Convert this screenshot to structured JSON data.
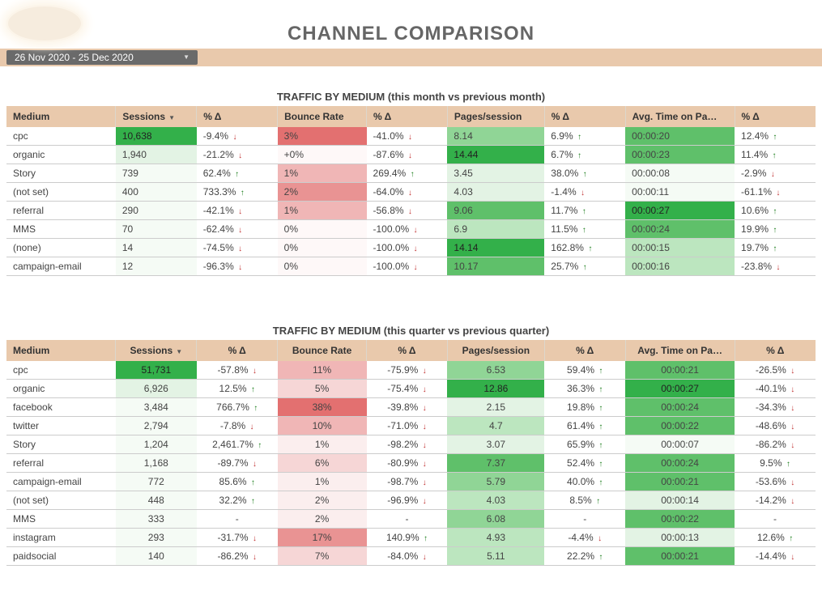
{
  "header": {
    "title": "CHANNEL COMPARISON",
    "date_range": "26 Nov 2020 - 25 Dec 2020"
  },
  "columns_labels": {
    "medium": "Medium",
    "sessions": "Sessions",
    "delta": "% Δ",
    "bounce": "Bounce Rate",
    "pages": "Pages/session",
    "time": "Avg. Time on Pa…"
  },
  "table1": {
    "title": "TRAFFIC BY MEDIUM (this month vs previous month)",
    "rows": [
      {
        "medium": "cpc",
        "sessions": "10,638",
        "sessions_cls": "g5",
        "sessions_d": "-9.4%",
        "sessions_dir": "down",
        "bounce": "3%",
        "bounce_cls": "r5",
        "bounce_d": "-41.0%",
        "bounce_dir": "down",
        "pages": "8.14",
        "pages_cls": "g3",
        "pages_d": "6.9%",
        "pages_dir": "up",
        "time": "00:00:20",
        "time_cls": "g4",
        "time_d": "12.4%",
        "time_dir": "up"
      },
      {
        "medium": "organic",
        "sessions": "1,940",
        "sessions_cls": "g1",
        "sessions_d": "-21.2%",
        "sessions_dir": "down",
        "bounce": "+0%",
        "bounce_cls": "r0",
        "bounce_d": "-87.6%",
        "bounce_dir": "down",
        "pages": "14.44",
        "pages_cls": "g5",
        "pages_d": "6.7%",
        "pages_dir": "up",
        "time": "00:00:23",
        "time_cls": "g4",
        "time_d": "11.4%",
        "time_dir": "up"
      },
      {
        "medium": "Story",
        "sessions": "739",
        "sessions_cls": "g0",
        "sessions_d": "62.4%",
        "sessions_dir": "up",
        "bounce": "1%",
        "bounce_cls": "r3",
        "bounce_d": "269.4%",
        "bounce_dir": "up",
        "pages": "3.45",
        "pages_cls": "g1",
        "pages_d": "38.0%",
        "pages_dir": "up",
        "time": "00:00:08",
        "time_cls": "g0",
        "time_d": "-2.9%",
        "time_dir": "down"
      },
      {
        "medium": "(not set)",
        "sessions": "400",
        "sessions_cls": "g0",
        "sessions_d": "733.3%",
        "sessions_dir": "up",
        "bounce": "2%",
        "bounce_cls": "r4",
        "bounce_d": "-64.0%",
        "bounce_dir": "down",
        "pages": "4.03",
        "pages_cls": "g1",
        "pages_d": "-1.4%",
        "pages_dir": "down",
        "time": "00:00:11",
        "time_cls": "g0",
        "time_d": "-61.1%",
        "time_dir": "down"
      },
      {
        "medium": "referral",
        "sessions": "290",
        "sessions_cls": "g0",
        "sessions_d": "-42.1%",
        "sessions_dir": "down",
        "bounce": "1%",
        "bounce_cls": "r3",
        "bounce_d": "-56.8%",
        "bounce_dir": "down",
        "pages": "9.06",
        "pages_cls": "g4",
        "pages_d": "11.7%",
        "pages_dir": "up",
        "time": "00:00:27",
        "time_cls": "g5",
        "time_d": "10.6%",
        "time_dir": "up"
      },
      {
        "medium": "MMS",
        "sessions": "70",
        "sessions_cls": "g0",
        "sessions_d": "-62.4%",
        "sessions_dir": "down",
        "bounce": "0%",
        "bounce_cls": "r0",
        "bounce_d": "-100.0%",
        "bounce_dir": "down",
        "pages": "6.9",
        "pages_cls": "g2",
        "pages_d": "11.5%",
        "pages_dir": "up",
        "time": "00:00:24",
        "time_cls": "g4",
        "time_d": "19.9%",
        "time_dir": "up"
      },
      {
        "medium": "(none)",
        "sessions": "14",
        "sessions_cls": "g0",
        "sessions_d": "-74.5%",
        "sessions_dir": "down",
        "bounce": "0%",
        "bounce_cls": "r0",
        "bounce_d": "-100.0%",
        "bounce_dir": "down",
        "pages": "14.14",
        "pages_cls": "g5",
        "pages_d": "162.8%",
        "pages_dir": "up",
        "time": "00:00:15",
        "time_cls": "g2",
        "time_d": "19.7%",
        "time_dir": "up"
      },
      {
        "medium": "campaign-email",
        "sessions": "12",
        "sessions_cls": "g0",
        "sessions_d": "-96.3%",
        "sessions_dir": "down",
        "bounce": "0%",
        "bounce_cls": "r0",
        "bounce_d": "-100.0%",
        "bounce_dir": "down",
        "pages": "10.17",
        "pages_cls": "g4",
        "pages_d": "25.7%",
        "pages_dir": "up",
        "time": "00:00:16",
        "time_cls": "g2",
        "time_d": "-23.8%",
        "time_dir": "down"
      }
    ]
  },
  "table2": {
    "title": "TRAFFIC BY MEDIUM (this quarter vs previous quarter)",
    "align": "center",
    "rows": [
      {
        "medium": "cpc",
        "sessions": "51,731",
        "sessions_cls": "g5",
        "sessions_d": "-57.8%",
        "sessions_dir": "down",
        "bounce": "11%",
        "bounce_cls": "r3",
        "bounce_d": "-75.9%",
        "bounce_dir": "down",
        "pages": "6.53",
        "pages_cls": "g3",
        "pages_d": "59.4%",
        "pages_dir": "up",
        "time": "00:00:21",
        "time_cls": "g4",
        "time_d": "-26.5%",
        "time_dir": "down"
      },
      {
        "medium": "organic",
        "sessions": "6,926",
        "sessions_cls": "g1",
        "sessions_d": "12.5%",
        "sessions_dir": "up",
        "bounce": "5%",
        "bounce_cls": "r2",
        "bounce_d": "-75.4%",
        "bounce_dir": "down",
        "pages": "12.86",
        "pages_cls": "g5",
        "pages_d": "36.3%",
        "pages_dir": "up",
        "time": "00:00:27",
        "time_cls": "g5",
        "time_d": "-40.1%",
        "time_dir": "down"
      },
      {
        "medium": "facebook",
        "sessions": "3,484",
        "sessions_cls": "g0",
        "sessions_d": "766.7%",
        "sessions_dir": "up",
        "bounce": "38%",
        "bounce_cls": "r5",
        "bounce_d": "-39.8%",
        "bounce_dir": "down",
        "pages": "2.15",
        "pages_cls": "g1",
        "pages_d": "19.8%",
        "pages_dir": "up",
        "time": "00:00:24",
        "time_cls": "g4",
        "time_d": "-34.3%",
        "time_dir": "down"
      },
      {
        "medium": "twitter",
        "sessions": "2,794",
        "sessions_cls": "g0",
        "sessions_d": "-7.8%",
        "sessions_dir": "down",
        "bounce": "10%",
        "bounce_cls": "r3",
        "bounce_d": "-71.0%",
        "bounce_dir": "down",
        "pages": "4.7",
        "pages_cls": "g2",
        "pages_d": "61.4%",
        "pages_dir": "up",
        "time": "00:00:22",
        "time_cls": "g4",
        "time_d": "-48.6%",
        "time_dir": "down"
      },
      {
        "medium": "Story",
        "sessions": "1,204",
        "sessions_cls": "g0",
        "sessions_d": "2,461.7%",
        "sessions_dir": "up",
        "bounce": "1%",
        "bounce_cls": "r1",
        "bounce_d": "-98.2%",
        "bounce_dir": "down",
        "pages": "3.07",
        "pages_cls": "g1",
        "pages_d": "65.9%",
        "pages_dir": "up",
        "time": "00:00:07",
        "time_cls": "g0",
        "time_d": "-86.2%",
        "time_dir": "down"
      },
      {
        "medium": "referral",
        "sessions": "1,168",
        "sessions_cls": "g0",
        "sessions_d": "-89.7%",
        "sessions_dir": "down",
        "bounce": "6%",
        "bounce_cls": "r2",
        "bounce_d": "-80.9%",
        "bounce_dir": "down",
        "pages": "7.37",
        "pages_cls": "g4",
        "pages_d": "52.4%",
        "pages_dir": "up",
        "time": "00:00:24",
        "time_cls": "g4",
        "time_d": "9.5%",
        "time_dir": "up"
      },
      {
        "medium": "campaign-email",
        "sessions": "772",
        "sessions_cls": "g0",
        "sessions_d": "85.6%",
        "sessions_dir": "up",
        "bounce": "1%",
        "bounce_cls": "r1",
        "bounce_d": "-98.7%",
        "bounce_dir": "down",
        "pages": "5.79",
        "pages_cls": "g3",
        "pages_d": "40.0%",
        "pages_dir": "up",
        "time": "00:00:21",
        "time_cls": "g4",
        "time_d": "-53.6%",
        "time_dir": "down"
      },
      {
        "medium": "(not set)",
        "sessions": "448",
        "sessions_cls": "g0",
        "sessions_d": "32.2%",
        "sessions_dir": "up",
        "bounce": "2%",
        "bounce_cls": "r1",
        "bounce_d": "-96.9%",
        "bounce_dir": "down",
        "pages": "4.03",
        "pages_cls": "g2",
        "pages_d": "8.5%",
        "pages_dir": "up",
        "time": "00:00:14",
        "time_cls": "g1",
        "time_d": "-14.2%",
        "time_dir": "down"
      },
      {
        "medium": "MMS",
        "sessions": "333",
        "sessions_cls": "g0",
        "sessions_d": "-",
        "sessions_dir": "",
        "bounce": "2%",
        "bounce_cls": "r1",
        "bounce_d": "-",
        "bounce_dir": "",
        "pages": "6.08",
        "pages_cls": "g3",
        "pages_d": "-",
        "pages_dir": "",
        "time": "00:00:22",
        "time_cls": "g4",
        "time_d": "-",
        "time_dir": ""
      },
      {
        "medium": "instagram",
        "sessions": "293",
        "sessions_cls": "g0",
        "sessions_d": "-31.7%",
        "sessions_dir": "down",
        "bounce": "17%",
        "bounce_cls": "r4",
        "bounce_d": "140.9%",
        "bounce_dir": "up",
        "pages": "4.93",
        "pages_cls": "g2",
        "pages_d": "-4.4%",
        "pages_dir": "down",
        "time": "00:00:13",
        "time_cls": "g1",
        "time_d": "12.6%",
        "time_dir": "up"
      },
      {
        "medium": "paidsocial",
        "sessions": "140",
        "sessions_cls": "g0",
        "sessions_d": "-86.2%",
        "sessions_dir": "down",
        "bounce": "7%",
        "bounce_cls": "r2",
        "bounce_d": "-84.0%",
        "bounce_dir": "down",
        "pages": "5.11",
        "pages_cls": "g2",
        "pages_d": "22.2%",
        "pages_dir": "up",
        "time": "00:00:21",
        "time_cls": "g4",
        "time_d": "-14.4%",
        "time_dir": "down"
      }
    ]
  }
}
